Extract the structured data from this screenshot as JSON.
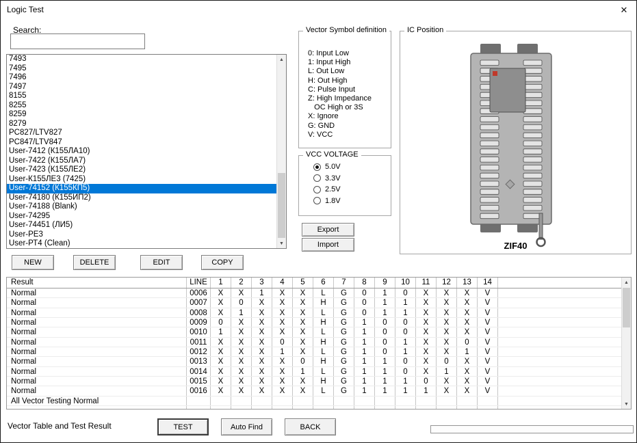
{
  "window": {
    "title": "Logic Test",
    "close_icon": "✕"
  },
  "search": {
    "label": "Search:",
    "value": ""
  },
  "chip_list": {
    "selected_index": 14,
    "items": [
      "7493",
      "7495",
      "7496",
      "7497",
      "8155",
      "8255",
      "8259",
      "8279",
      "PC827/LTV827",
      "PC847/LTV847",
      "User-7412 (К155ЛА10)",
      "User-7422 (К155ЛА7)",
      "User-7423 (К155ЛЕ2)",
      "User-К155ЛЕ3 (7425)",
      "User-74152 (К155КП5)",
      "User-74180 (К155ИП2)",
      "User-74188 (Blank)",
      "User-74295",
      "User-74451 (ЛИ5)",
      "User-РЕ3",
      "User-РТ4 (Clean)"
    ]
  },
  "list_actions": {
    "new": "NEW",
    "delete": "DELETE",
    "edit": "EDIT",
    "copy": "COPY"
  },
  "vector_symbols": {
    "title": "Vector Symbol definition",
    "lines": [
      "0: Input Low",
      "1: Input High",
      "L: Out Low",
      "H: Out High",
      "C: Pulse Input",
      "Z: High Impedance",
      "   OC High or 3S",
      "X: Ignore",
      "G: GND",
      "V: VCC"
    ]
  },
  "vcc_voltage": {
    "title": "VCC VOLTAGE",
    "options": [
      {
        "label": "5.0V",
        "selected": true
      },
      {
        "label": "3.3V",
        "selected": false
      },
      {
        "label": "2.5V",
        "selected": false
      },
      {
        "label": "1.8V",
        "selected": false
      }
    ]
  },
  "transfer": {
    "export": "Export",
    "import": "Import"
  },
  "ic_position": {
    "title": "IC Position",
    "socket_label": "ZIF40"
  },
  "result_table": {
    "headers": [
      "Result",
      "LINE",
      "1",
      "2",
      "3",
      "4",
      "5",
      "6",
      "7",
      "8",
      "9",
      "10",
      "11",
      "12",
      "13",
      "14"
    ],
    "rows": [
      {
        "result": "Normal",
        "line": "0006",
        "pins": [
          "X",
          "X",
          "1",
          "X",
          "X",
          "L",
          "G",
          "0",
          "1",
          "0",
          "X",
          "X",
          "X",
          "V"
        ]
      },
      {
        "result": "Normal",
        "line": "0007",
        "pins": [
          "X",
          "0",
          "X",
          "X",
          "X",
          "H",
          "G",
          "0",
          "1",
          "1",
          "X",
          "X",
          "X",
          "V"
        ]
      },
      {
        "result": "Normal",
        "line": "0008",
        "pins": [
          "X",
          "1",
          "X",
          "X",
          "X",
          "L",
          "G",
          "0",
          "1",
          "1",
          "X",
          "X",
          "X",
          "V"
        ]
      },
      {
        "result": "Normal",
        "line": "0009",
        "pins": [
          "0",
          "X",
          "X",
          "X",
          "X",
          "H",
          "G",
          "1",
          "0",
          "0",
          "X",
          "X",
          "X",
          "V"
        ]
      },
      {
        "result": "Normal",
        "line": "0010",
        "pins": [
          "1",
          "X",
          "X",
          "X",
          "X",
          "L",
          "G",
          "1",
          "0",
          "0",
          "X",
          "X",
          "X",
          "V"
        ]
      },
      {
        "result": "Normal",
        "line": "0011",
        "pins": [
          "X",
          "X",
          "X",
          "0",
          "X",
          "H",
          "G",
          "1",
          "0",
          "1",
          "X",
          "X",
          "0",
          "V"
        ]
      },
      {
        "result": "Normal",
        "line": "0012",
        "pins": [
          "X",
          "X",
          "X",
          "1",
          "X",
          "L",
          "G",
          "1",
          "0",
          "1",
          "X",
          "X",
          "1",
          "V"
        ]
      },
      {
        "result": "Normal",
        "line": "0013",
        "pins": [
          "X",
          "X",
          "X",
          "X",
          "0",
          "H",
          "G",
          "1",
          "1",
          "0",
          "X",
          "0",
          "X",
          "V"
        ]
      },
      {
        "result": "Normal",
        "line": "0014",
        "pins": [
          "X",
          "X",
          "X",
          "X",
          "1",
          "L",
          "G",
          "1",
          "1",
          "0",
          "X",
          "1",
          "X",
          "V"
        ]
      },
      {
        "result": "Normal",
        "line": "0015",
        "pins": [
          "X",
          "X",
          "X",
          "X",
          "X",
          "H",
          "G",
          "1",
          "1",
          "1",
          "0",
          "X",
          "X",
          "V"
        ]
      },
      {
        "result": "Normal",
        "line": "0016",
        "pins": [
          "X",
          "X",
          "X",
          "X",
          "X",
          "L",
          "G",
          "1",
          "1",
          "1",
          "1",
          "X",
          "X",
          "V"
        ]
      }
    ],
    "footer": "All Vector Testing Normal"
  },
  "bottom_bar": {
    "status_label": "Vector Table and Test Result",
    "test": "TEST",
    "auto_find": "Auto Find",
    "back": "BACK"
  }
}
